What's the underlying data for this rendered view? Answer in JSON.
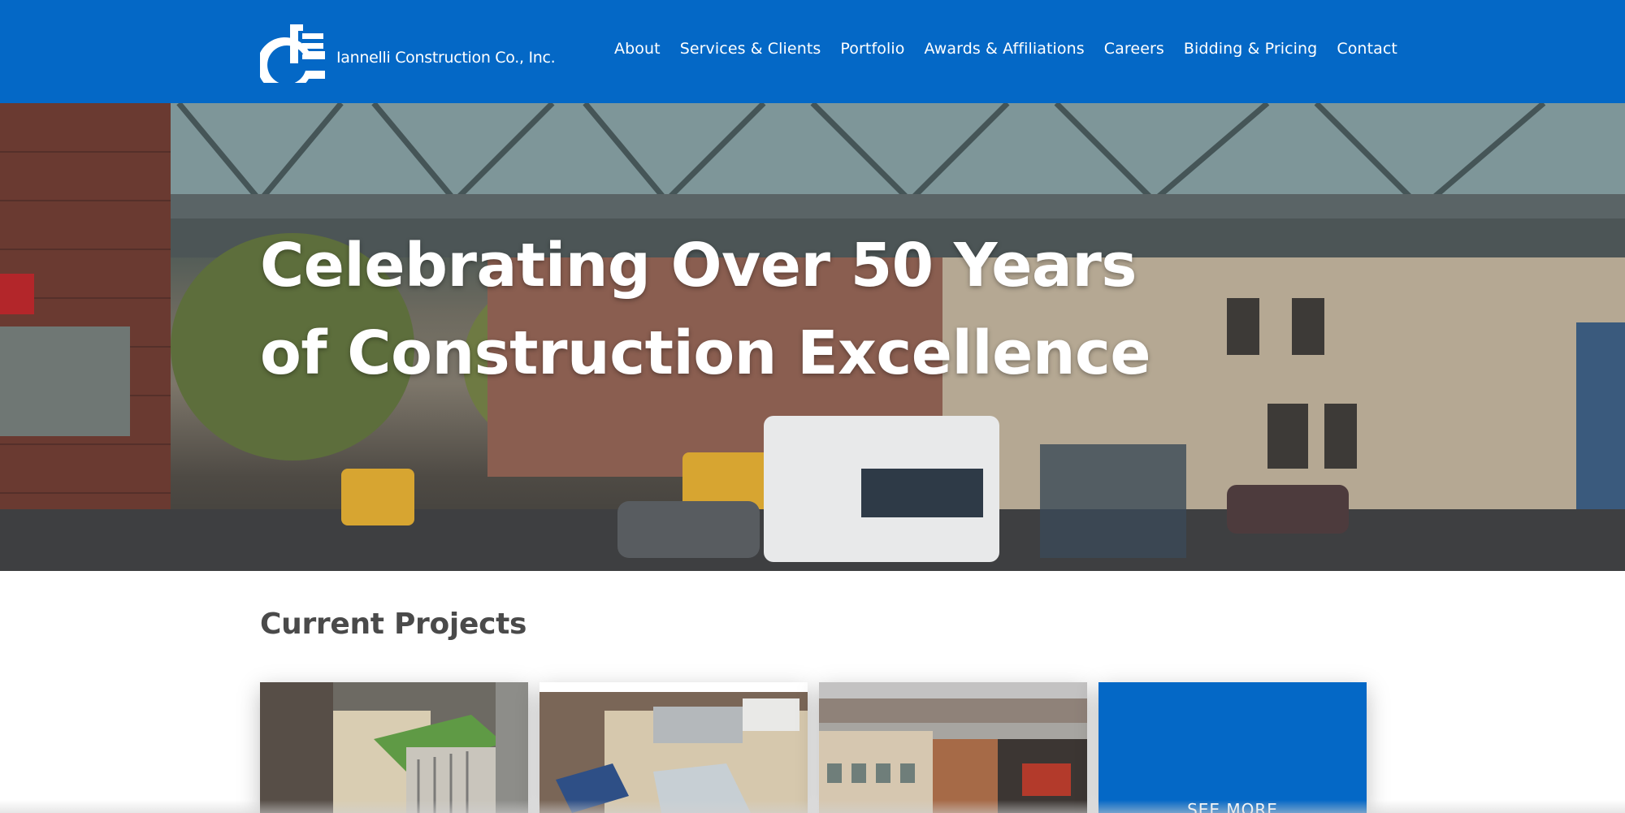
{
  "header": {
    "company_name": "Iannelli Construction Co., Inc.",
    "logo_icon": "ic-monogram-logo",
    "brand_color": "#0468c6",
    "nav": [
      {
        "label": "About"
      },
      {
        "label": "Services & Clients"
      },
      {
        "label": "Portfolio"
      },
      {
        "label": "Awards & Affiliations"
      },
      {
        "label": "Careers"
      },
      {
        "label": "Bidding & Pricing"
      },
      {
        "label": "Contact"
      }
    ]
  },
  "hero": {
    "title_line1": "Celebrating Over 50 Years",
    "title_line2": "of Construction Excellence"
  },
  "projects": {
    "heading": "Current Projects",
    "see_more_label": "SEE MORE"
  }
}
